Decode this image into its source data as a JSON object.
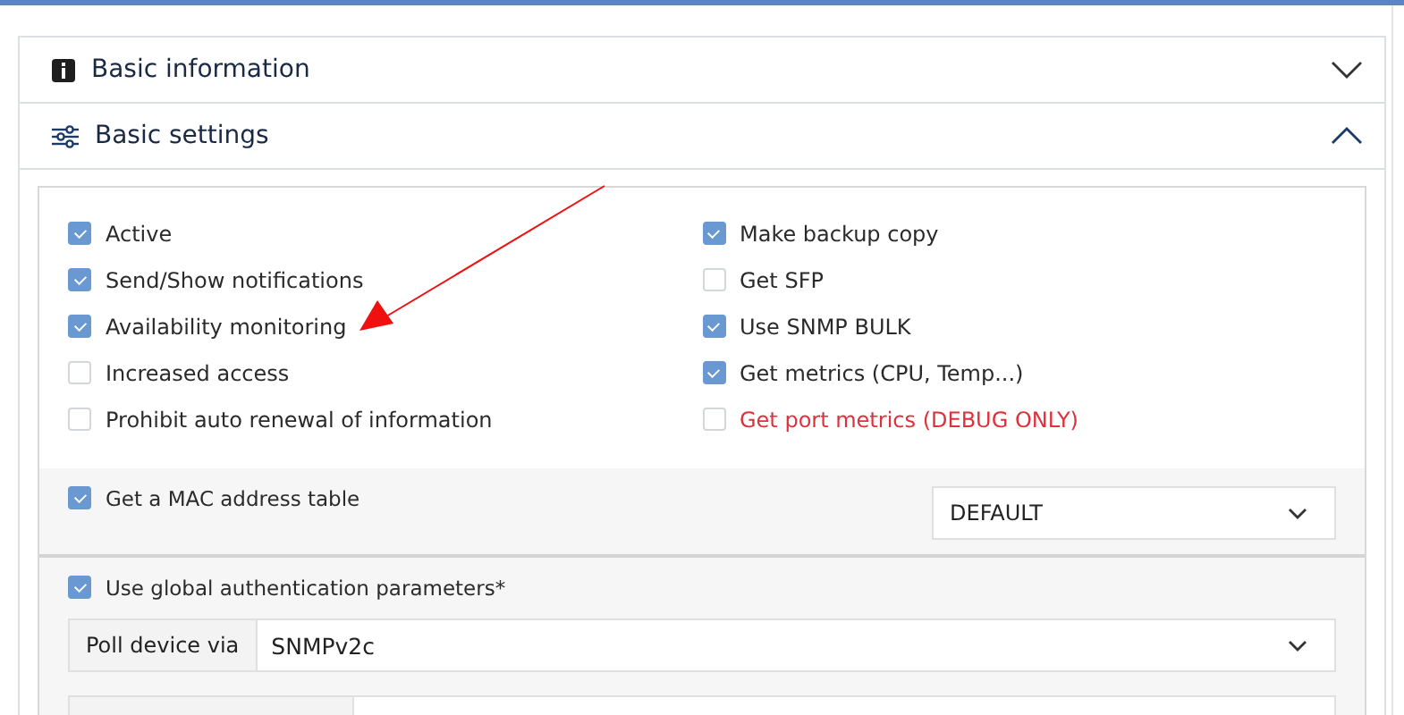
{
  "sections": [
    {
      "title": "Basic information",
      "expanded": false
    },
    {
      "title": "Basic settings",
      "expanded": true
    }
  ],
  "options_left": [
    {
      "label": "Active",
      "checked": true,
      "warning": false
    },
    {
      "label": "Send/Show notifications",
      "checked": true,
      "warning": false
    },
    {
      "label": "Availability monitoring",
      "checked": true,
      "warning": false
    },
    {
      "label": "Increased access",
      "checked": false,
      "warning": false
    },
    {
      "label": "Prohibit auto renewal of information",
      "checked": false,
      "warning": false
    }
  ],
  "options_right": [
    {
      "label": "Make backup copy",
      "checked": true,
      "warning": false
    },
    {
      "label": "Get SFP",
      "checked": false,
      "warning": false
    },
    {
      "label": "Use SNMP BULK",
      "checked": true,
      "warning": false
    },
    {
      "label": "Get metrics (CPU, Temp...)",
      "checked": true,
      "warning": false
    },
    {
      "label": "Get port metrics (DEBUG ONLY)",
      "checked": false,
      "warning": true
    }
  ],
  "mac_table": {
    "label": "Get a MAC address table",
    "checked": true,
    "mode": "DEFAULT"
  },
  "auth": {
    "label": "Use global authentication parameters*",
    "checked": true,
    "poll_label": "Poll device via",
    "poll_value": "SNMPv2c"
  }
}
